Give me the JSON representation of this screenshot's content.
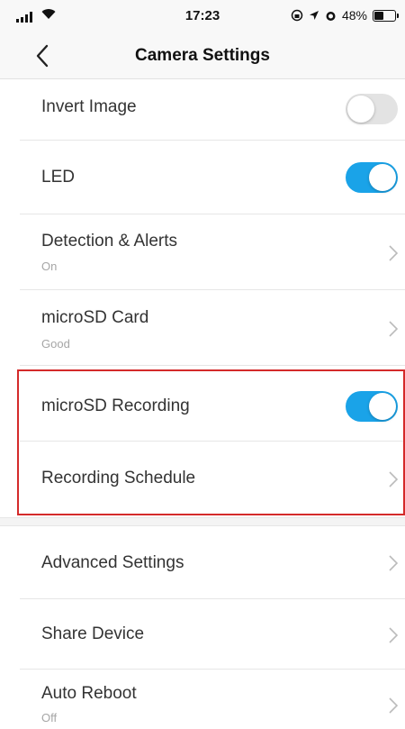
{
  "status_bar": {
    "time": "17:23",
    "battery": "48%",
    "battery_level": 0.48
  },
  "nav": {
    "title": "Camera Settings"
  },
  "settings": {
    "invert_image": {
      "label": "Invert Image",
      "enabled": false
    },
    "led": {
      "label": "LED",
      "enabled": true
    },
    "detection_alerts": {
      "label": "Detection & Alerts",
      "value": "On"
    },
    "microsd_card": {
      "label": "microSD Card",
      "value": "Good"
    },
    "microsd_recording": {
      "label": "microSD Recording",
      "enabled": true
    },
    "recording_schedule": {
      "label": "Recording Schedule"
    },
    "advanced_settings": {
      "label": "Advanced Settings"
    },
    "share_device": {
      "label": "Share Device"
    },
    "auto_reboot": {
      "label": "Auto Reboot",
      "value": "Off"
    }
  },
  "colors": {
    "accent": "#1aa3e8",
    "highlight": "#d42a2a",
    "toggle_off": "#e3e3e3"
  }
}
